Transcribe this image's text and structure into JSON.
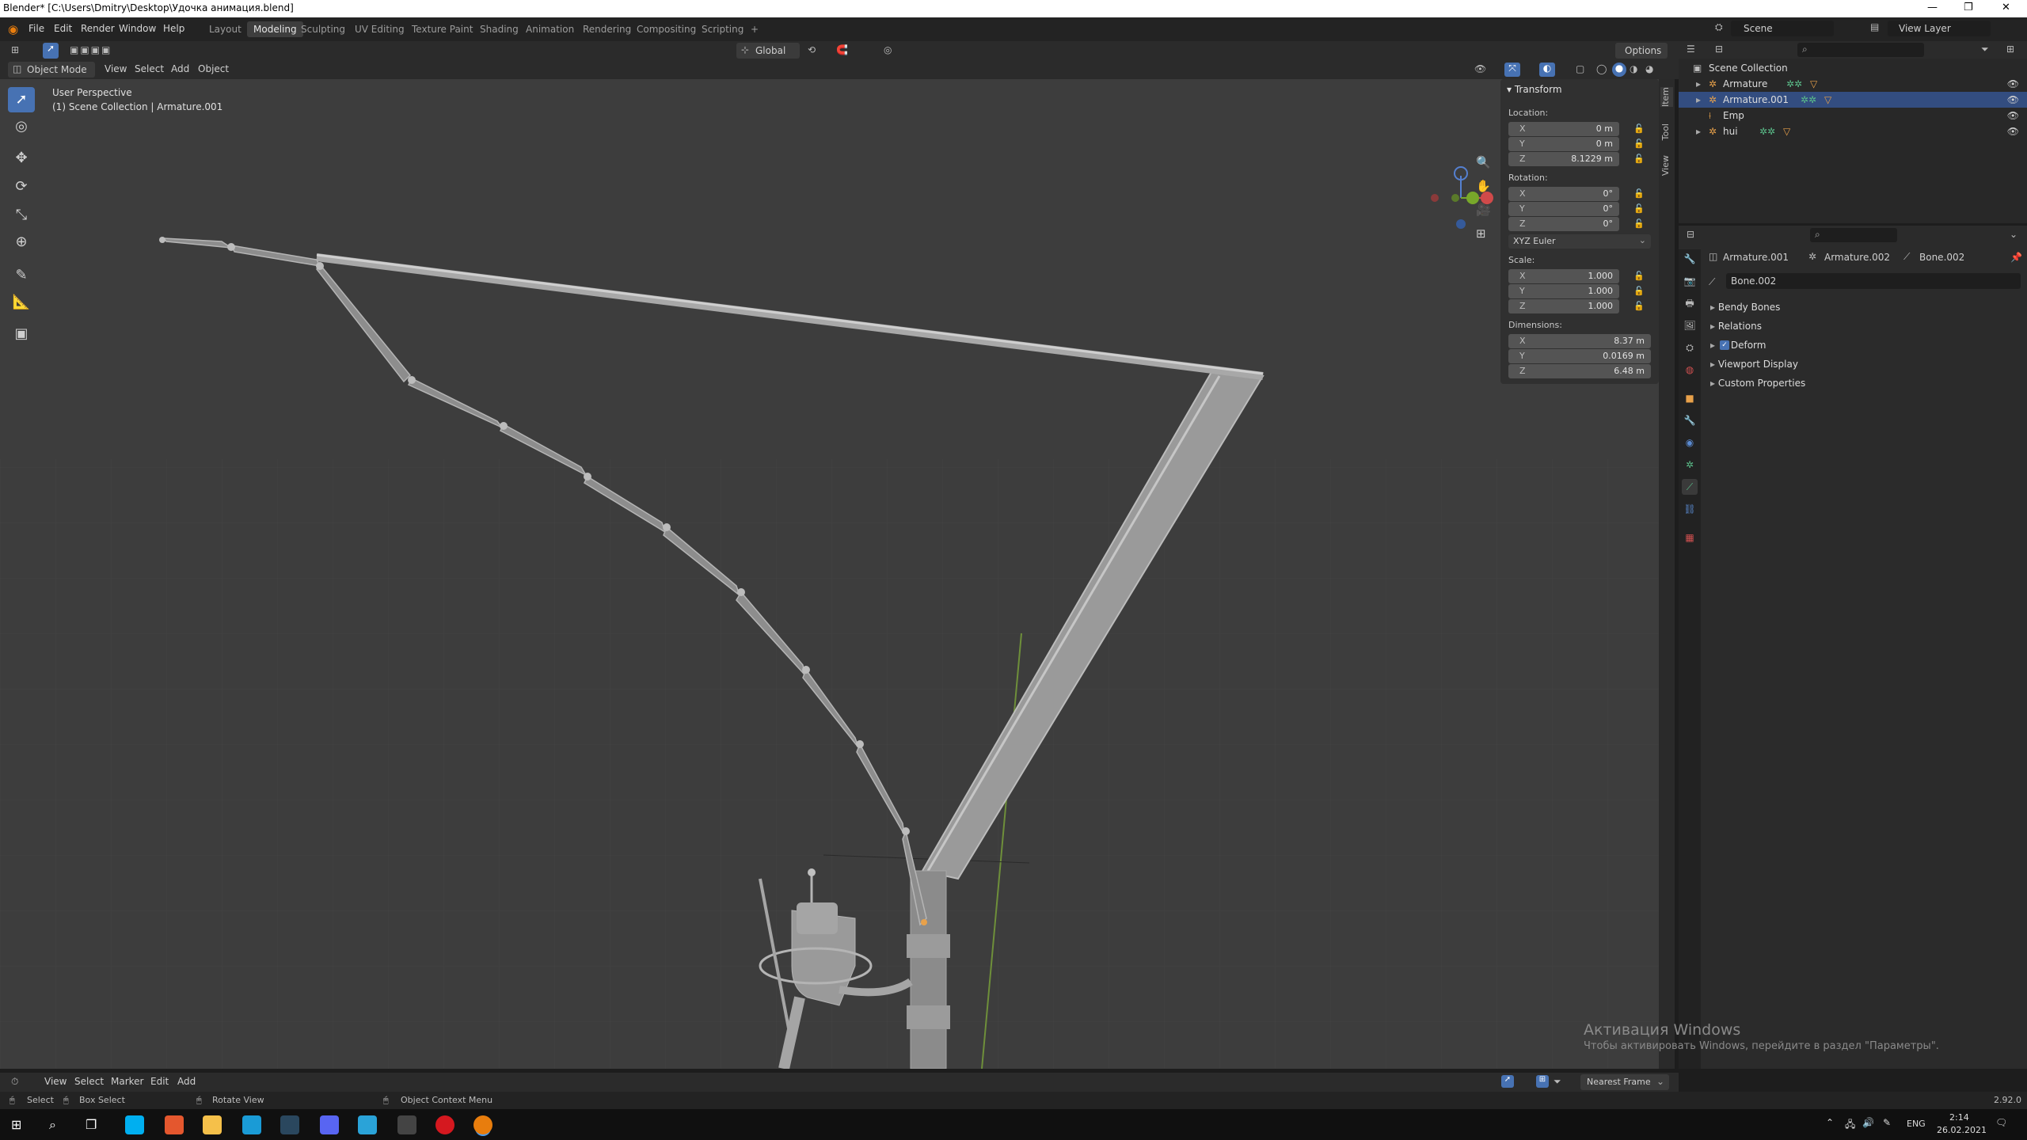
{
  "window": {
    "title": "Blender* [C:\\Users\\Dmitry\\Desktop\\Удочка анимация.blend]",
    "controls": [
      "—",
      "❐",
      "✕"
    ]
  },
  "menu": [
    "File",
    "Edit",
    "Render",
    "Window",
    "Help"
  ],
  "workspaces": {
    "tabs": [
      "Layout",
      "Modeling",
      "Sculpting",
      "UV Editing",
      "Texture Paint",
      "Shading",
      "Animation",
      "Rendering",
      "Compositing",
      "Scripting",
      "+"
    ],
    "active": "Modeling"
  },
  "scene": {
    "label": "Scene",
    "view_layer": "View Layer"
  },
  "viewport_header": {
    "mode": "Object Mode",
    "menus": [
      "View",
      "Select",
      "Add",
      "Object"
    ],
    "orientation": "Global",
    "options": "Options"
  },
  "viewport": {
    "perspective": "User Perspective",
    "collection": "(1) Scene Collection | Armature.001"
  },
  "transform": {
    "header": "Transform",
    "location_label": "Location:",
    "location": [
      {
        "axis": "X",
        "value": "0 m"
      },
      {
        "axis": "Y",
        "value": "0 m"
      },
      {
        "axis": "Z",
        "value": "8.1229 m"
      }
    ],
    "rotation_label": "Rotation:",
    "rotation": [
      {
        "axis": "X",
        "value": "0°"
      },
      {
        "axis": "Y",
        "value": "0°"
      },
      {
        "axis": "Z",
        "value": "0°"
      }
    ],
    "rotation_mode": "XYZ Euler",
    "scale_label": "Scale:",
    "scale": [
      {
        "axis": "X",
        "value": "1.000"
      },
      {
        "axis": "Y",
        "value": "1.000"
      },
      {
        "axis": "Z",
        "value": "1.000"
      }
    ],
    "dimensions_label": "Dimensions:",
    "dimensions": [
      {
        "axis": "X",
        "value": "8.37 m"
      },
      {
        "axis": "Y",
        "value": "0.0169 m"
      },
      {
        "axis": "Z",
        "value": "6.48 m"
      }
    ]
  },
  "side_tabs": [
    "Item",
    "Tool",
    "View"
  ],
  "outliner": {
    "root": "Scene Collection",
    "items": [
      "Armature",
      "Armature.001",
      "Emp",
      "hui"
    ]
  },
  "properties": {
    "breadcrumb": [
      "Armature.001",
      "Armature.002",
      "Bone.002"
    ],
    "bone_name": "Bone.002",
    "panels": [
      "Bendy Bones",
      "Relations",
      "Deform",
      "Viewport Display",
      "Custom Properties"
    ],
    "deform_checked": true
  },
  "timeline": {
    "menus": [
      "View",
      "Select",
      "Marker",
      "Edit",
      "Add"
    ],
    "snap": "Nearest Frame"
  },
  "status": {
    "select": "Select",
    "box_select": "Box Select",
    "rotate_view": "Rotate View",
    "context_menu": "Object Context Menu",
    "version": "2.92.0"
  },
  "activation": {
    "title": "Активация Windows",
    "subtitle": "Чтобы активировать Windows, перейдите в раздел \"Параметры\"."
  },
  "taskbar": {
    "lang": "ENG",
    "time": "2:14",
    "date": "26.02.2021"
  }
}
